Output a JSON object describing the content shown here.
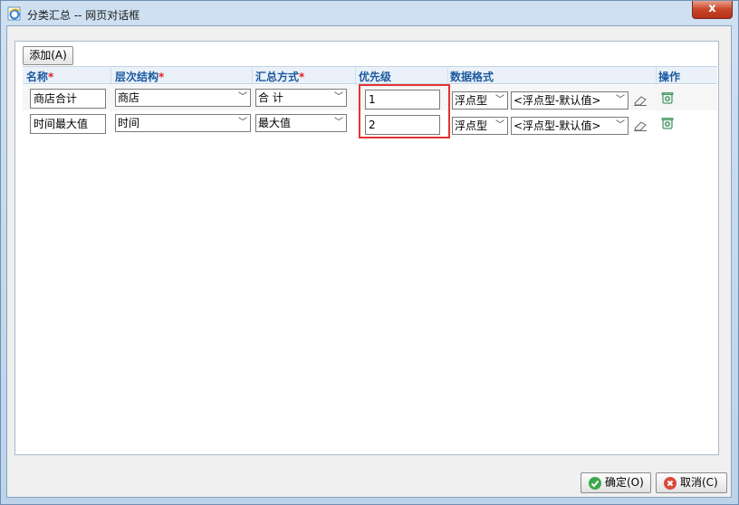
{
  "window": {
    "title": "分类汇总 -- 网页对话框",
    "close_label": "x"
  },
  "toolbar": {
    "add_label": "添加(A)"
  },
  "headers": {
    "name": "名称",
    "hierarchy": "层次结构",
    "summary_method": "汇总方式",
    "priority": "优先级",
    "data_format": "数据格式",
    "action": "操作",
    "required_mark": "*"
  },
  "rows": [
    {
      "name": "商店合计",
      "hierarchy": "商店",
      "summary_method": "合 计",
      "priority": "1",
      "format_type": "浮点型",
      "format_detail": "<浮点型-默认值>"
    },
    {
      "name": "时间最大值",
      "hierarchy": "时间",
      "summary_method": "最大值",
      "priority": "2",
      "format_type": "浮点型",
      "format_detail": "<浮点型-默认值>"
    }
  ],
  "footer": {
    "ok_label": "确定(O)",
    "cancel_label": "取消(C)"
  },
  "colors": {
    "header_text": "#1e5aa0",
    "required": "#e02020",
    "highlight": "#e53333",
    "ok_icon": "#3aa84a",
    "cancel_icon": "#d84a3a"
  },
  "icons": {
    "window": "ie-page-icon",
    "eraser": "eraser-icon",
    "trash": "trash-icon",
    "ok": "check-circle-icon",
    "cancel": "x-circle-icon"
  }
}
